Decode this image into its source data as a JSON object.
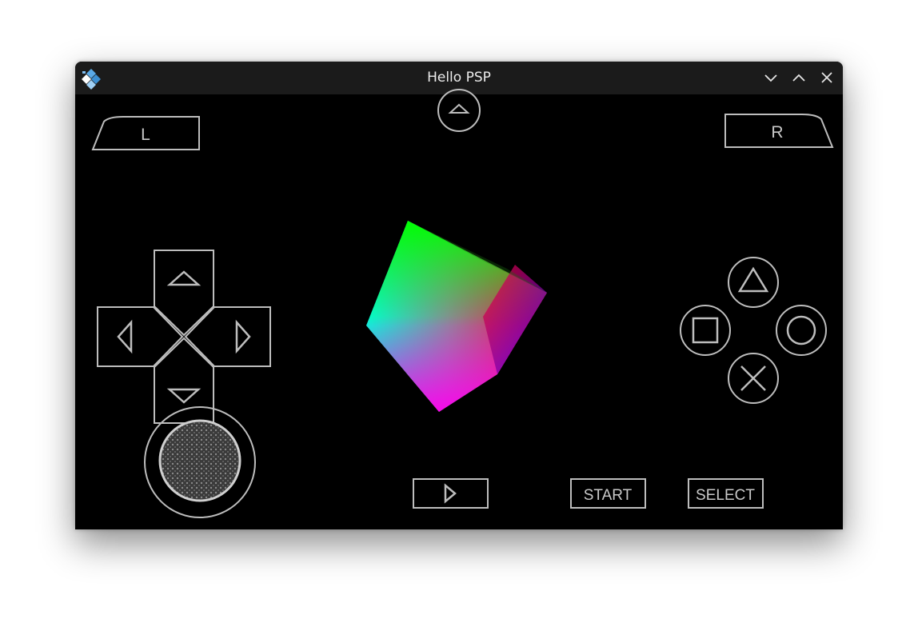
{
  "window": {
    "title": "Hello PSP",
    "app_icon": "ppsspp-logo-icon",
    "controls": [
      "minimize-icon",
      "maximize-icon",
      "close-icon"
    ]
  },
  "psp": {
    "shoulder_left_label": "L",
    "shoulder_right_label": "R",
    "start_label": "START",
    "select_label": "SELECT",
    "icons": {
      "speed": "triangle-up-icon",
      "dpad_up": "arrow-up-icon",
      "dpad_down": "arrow-down-icon",
      "dpad_left": "arrow-left-icon",
      "dpad_right": "arrow-right-icon",
      "triangle": "triangle-icon",
      "circle": "circle-icon",
      "cross": "cross-icon",
      "square": "square-icon",
      "fast_forward": "play-icon",
      "analog_stick": "analog-stick-icon"
    },
    "colors": {
      "control_stroke": "#bdbdbd",
      "background": "#000000",
      "titlebar": "#1b1b1b"
    }
  }
}
